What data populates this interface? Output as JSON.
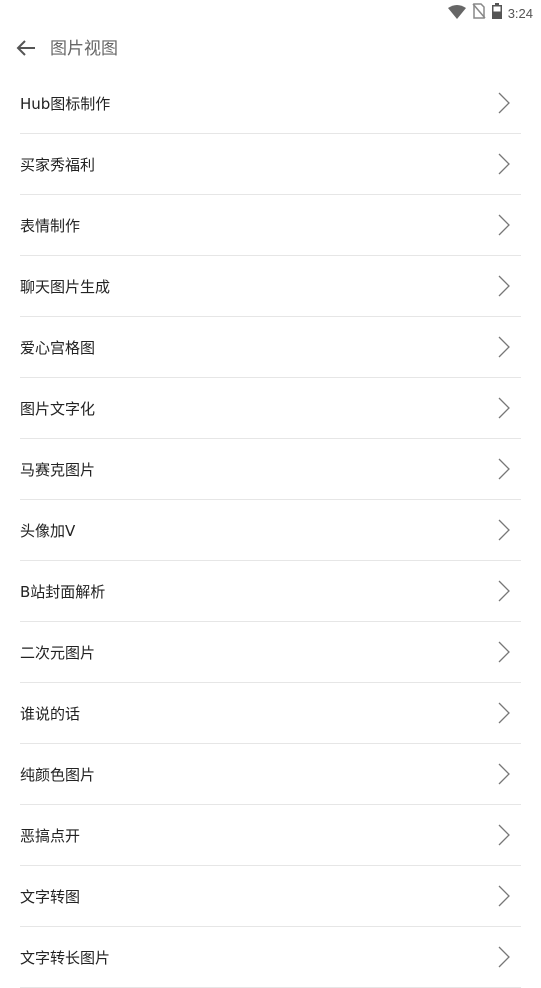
{
  "status_bar": {
    "time": "3:24",
    "icons": [
      "wifi-icon",
      "no-sim-icon",
      "battery-icon"
    ]
  },
  "header": {
    "title": "图片视图",
    "back_icon": "arrow-left-icon"
  },
  "list": {
    "items": [
      {
        "label": "Hub图标制作"
      },
      {
        "label": "买家秀福利"
      },
      {
        "label": "表情制作"
      },
      {
        "label": "聊天图片生成"
      },
      {
        "label": "爱心宫格图"
      },
      {
        "label": "图片文字化"
      },
      {
        "label": "马赛克图片"
      },
      {
        "label": "头像加V"
      },
      {
        "label": "B站封面解析"
      },
      {
        "label": "二次元图片"
      },
      {
        "label": "谁说的话"
      },
      {
        "label": "纯颜色图片"
      },
      {
        "label": "恶搞点开"
      },
      {
        "label": "文字转图"
      },
      {
        "label": "文字转长图片"
      }
    ]
  }
}
